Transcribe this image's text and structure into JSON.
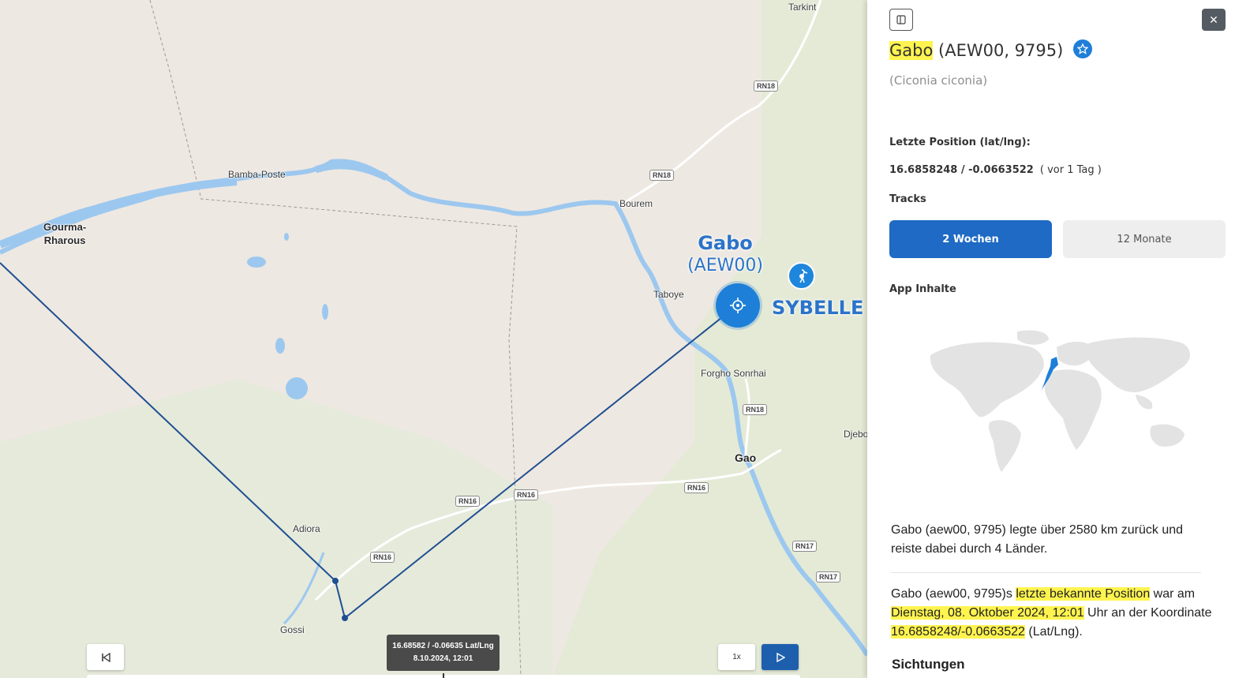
{
  "map": {
    "places": [
      {
        "id": "tarkint",
        "label": "Tarkint"
      },
      {
        "id": "bamba",
        "label": "Bamba-Poste"
      },
      {
        "id": "gourma",
        "label": "Gourma-\nRharous"
      },
      {
        "id": "bourem",
        "label": "Bourem"
      },
      {
        "id": "taboye",
        "label": "Taboye"
      },
      {
        "id": "forgho",
        "label": "Forgho Sonrhai"
      },
      {
        "id": "gao",
        "label": "Gao"
      },
      {
        "id": "djebo",
        "label": "Djebo"
      },
      {
        "id": "adiora",
        "label": "Adiora"
      },
      {
        "id": "gossi",
        "label": "Gossi"
      }
    ],
    "roads": [
      "RN18",
      "RN18",
      "RN18",
      "RN16",
      "RN16",
      "RN16",
      "RN16",
      "RN17",
      "RN17"
    ],
    "bird_label_name": "Gabo",
    "bird_label_code": "(AEW00)",
    "other_bird_label": "SYBELLE",
    "tooltip": {
      "coords": "16.68582 / -0.06635 Lat/Lng",
      "datetime": "8.10.2024, 12:01"
    },
    "controls": {
      "rewind_icon": "skip-back-icon",
      "speed_label": "1x",
      "play_icon": "play-icon"
    }
  },
  "panel": {
    "name": "Gabo",
    "ids": "(AEW00, 9795)",
    "favorite_icon": "star-icon",
    "species": "(Ciconia ciconia)",
    "last_position_label": "Letzte Position (lat/lng):",
    "last_position_value": "16.6858248 / -0.0663522",
    "last_position_ago": "( vor 1 Tag )",
    "tracks_label": "Tracks",
    "tracks_tabs": [
      {
        "label": "2 Wochen",
        "active": true
      },
      {
        "label": "12 Monate",
        "active": false
      }
    ],
    "app_content_label": "App Inhalte",
    "summary_text": "Gabo (aew00, 9795) legte über 2580 km zurück und reiste dabei durch 4 Länder.",
    "position_text": {
      "part1": "Gabo (aew00, 9795)s ",
      "part2": "letzte bekannte Position",
      "part3": " war am ",
      "part4": "Dienstag, 08. Oktober 2024, 12:01",
      "part5": " Uhr an der Koordinate ",
      "part6": "16.6858248/-0.0663522",
      "part7": " (Lat/Lng)."
    },
    "sightings_heading": "Sichtungen"
  },
  "colors": {
    "accent": "#1e6ac4",
    "marker": "#1e7fd8",
    "highlight": "#fff44f",
    "track": "#1f4f91",
    "water": "#9cc8ef"
  }
}
